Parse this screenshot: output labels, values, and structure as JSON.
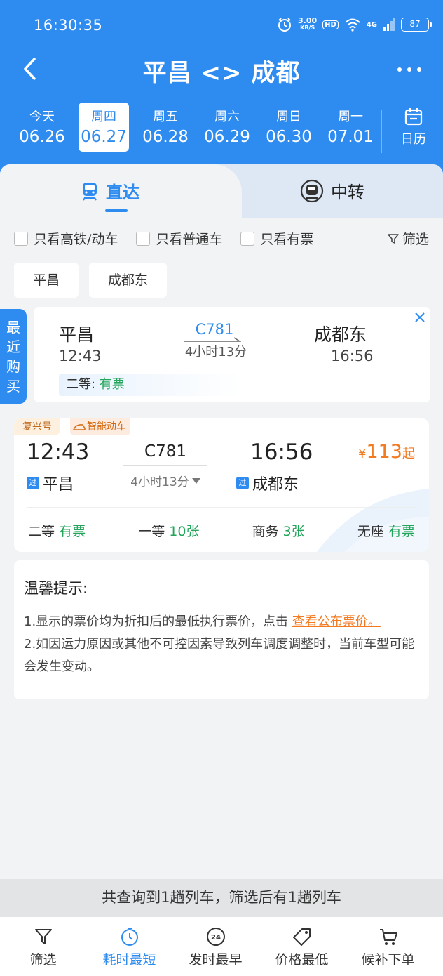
{
  "status": {
    "time": "16:30:35",
    "net_speed": "3.00",
    "net_unit": "KB/S",
    "hd": "HD",
    "signal": "4G",
    "battery": "87"
  },
  "header": {
    "title": "平昌 <> 成都"
  },
  "dates": [
    {
      "weekday": "今天",
      "date": "06.26"
    },
    {
      "weekday": "周四",
      "date": "06.27"
    },
    {
      "weekday": "周五",
      "date": "06.28"
    },
    {
      "weekday": "周六",
      "date": "06.29"
    },
    {
      "weekday": "周日",
      "date": "06.30"
    },
    {
      "weekday": "周一",
      "date": "07.01"
    }
  ],
  "calendar_label": "日历",
  "modes": {
    "direct": "直达",
    "transfer": "中转"
  },
  "filters": {
    "only_hs": "只看高铁/动车",
    "only_normal": "只看普通车",
    "only_available": "只看有票",
    "filter": "筛选"
  },
  "stations": [
    "平昌",
    "成都东"
  ],
  "recent": {
    "tag": "最近购买",
    "from": "平昌",
    "dep_time": "12:43",
    "train": "C781",
    "duration": "4小时13分",
    "to": "成都东",
    "arr_time": "16:56",
    "seat_class": "二等: ",
    "seat_status": "有票"
  },
  "train": {
    "tag_brand": "复兴号",
    "tag_ai": "智能动车",
    "dep_time": "12:43",
    "train_no": "C781",
    "duration": "4小时13分",
    "arr_time": "16:56",
    "from_pass": "过",
    "from": "平昌",
    "to_pass": "过",
    "to": "成都东",
    "price_symbol": "¥",
    "price": "113",
    "price_suffix": "起",
    "seats": [
      {
        "name": "二等",
        "status": "有票"
      },
      {
        "name": "一等",
        "status": "10张"
      },
      {
        "name": "商务",
        "status": "3张"
      },
      {
        "name": "无座",
        "status": "有票"
      }
    ]
  },
  "tips": {
    "title": "温馨提示:",
    "line1": "1.显示的票价均为折扣后的最低执行票价，点击 ",
    "link": "查看公布票价。",
    "line2": "2.如因运力原因或其他不可控因素导致列车调度调整时，当前车型可能会发生变动。"
  },
  "summary": "共查询到1趟列车，筛选后有1趟列车",
  "bottom": {
    "filter": "筛选",
    "fastest": "耗时最短",
    "earliest": "发时最早",
    "cheapest": "价格最低",
    "order": "候补下单"
  },
  "colors": {
    "primary": "#2e8cf0",
    "price": "#f47a20",
    "available": "#22a55a"
  }
}
